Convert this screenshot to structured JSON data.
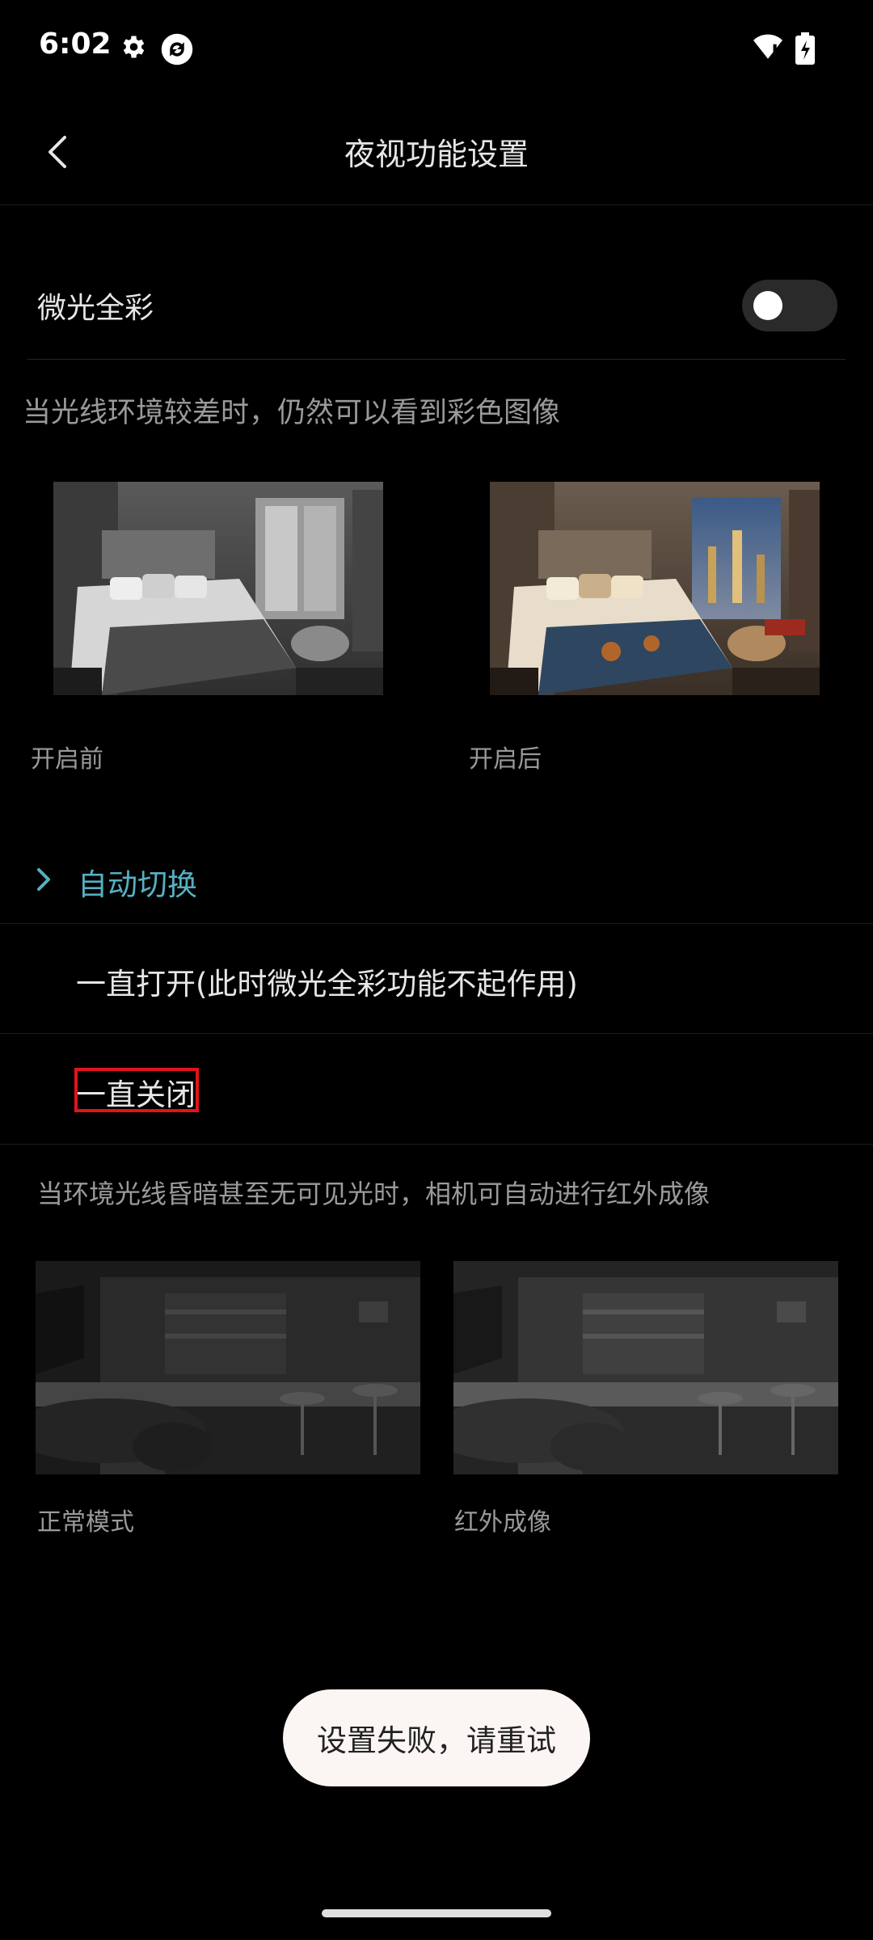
{
  "status_bar": {
    "time": "6:02",
    "icons": [
      "gear-icon",
      "sync-icon",
      "wifi-icon",
      "battery-icon"
    ]
  },
  "header": {
    "title": "夜视功能设置"
  },
  "low_light": {
    "label": "微光全彩",
    "enabled": false,
    "description": "当光线环境较差时，仍然可以看到彩色图像",
    "before_caption": "开启前",
    "after_caption": "开启后"
  },
  "infrared": {
    "current_mode": "自动切换",
    "options": [
      "一直打开(此时微光全彩功能不起作用)",
      "一直关闭"
    ],
    "description": "当环境光线昏暗甚至无可见光时，相机可自动进行红外成像",
    "normal_caption": "正常模式",
    "infrared_caption": "红外成像"
  },
  "toast": {
    "message": "设置失败，请重试"
  },
  "colors": {
    "accent": "#56b0c2",
    "highlight": "#e0141a",
    "background": "#000000"
  }
}
